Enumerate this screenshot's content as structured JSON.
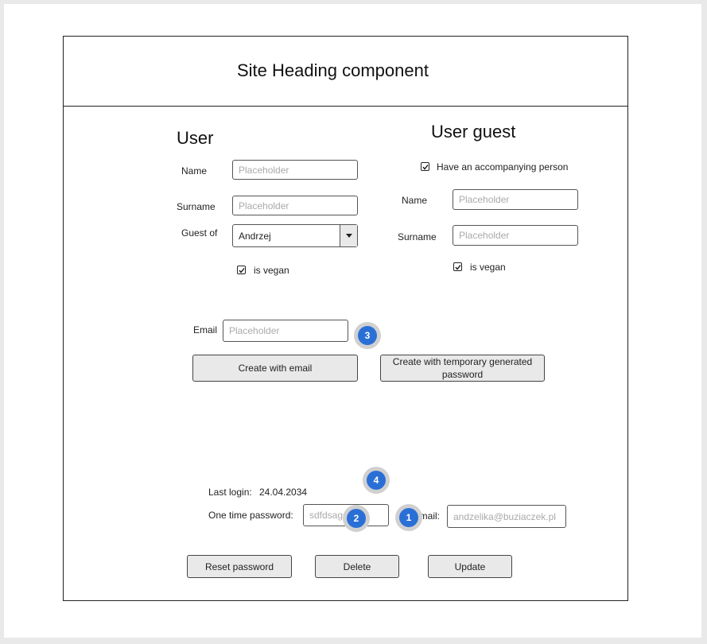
{
  "heading": {
    "title": "Site Heading component"
  },
  "user": {
    "title": "User",
    "name_label": "Name",
    "name_placeholder": "Placeholder",
    "surname_label": "Surname",
    "surname_placeholder": "Placeholder",
    "guest_of_label": "Guest of",
    "guest_of_value": "Andrzej",
    "vegan_label": "is vegan",
    "vegan_checked": true
  },
  "guest": {
    "title": "User guest",
    "accompanying_label": "Have an accompanying person",
    "accompanying_checked": true,
    "name_label": "Name",
    "name_placeholder": "Placeholder",
    "surname_label": "Surname",
    "surname_placeholder": "Placeholder",
    "vegan_label": "is vegan",
    "vegan_checked": true
  },
  "create": {
    "email_label": "Email",
    "email_placeholder": "Placeholder",
    "create_email_button": "Create with email",
    "create_temp_button": "Create with temporary generated password"
  },
  "account": {
    "last_login_label": "Last login:",
    "last_login_value": "24.04.2034",
    "otp_label": "One time password:",
    "otp_value": "sdfdsagdsdfs",
    "email_label": "email:",
    "email_value": "andzelika@buziaczek.pl"
  },
  "actions": {
    "reset_password": "Reset password",
    "delete": "Delete",
    "update": "Update"
  },
  "badges": {
    "b1": "1",
    "b2": "2",
    "b3": "3",
    "b4": "4"
  },
  "colors": {
    "badge": "#2a6fd6",
    "button_bg": "#e9e9e9"
  }
}
